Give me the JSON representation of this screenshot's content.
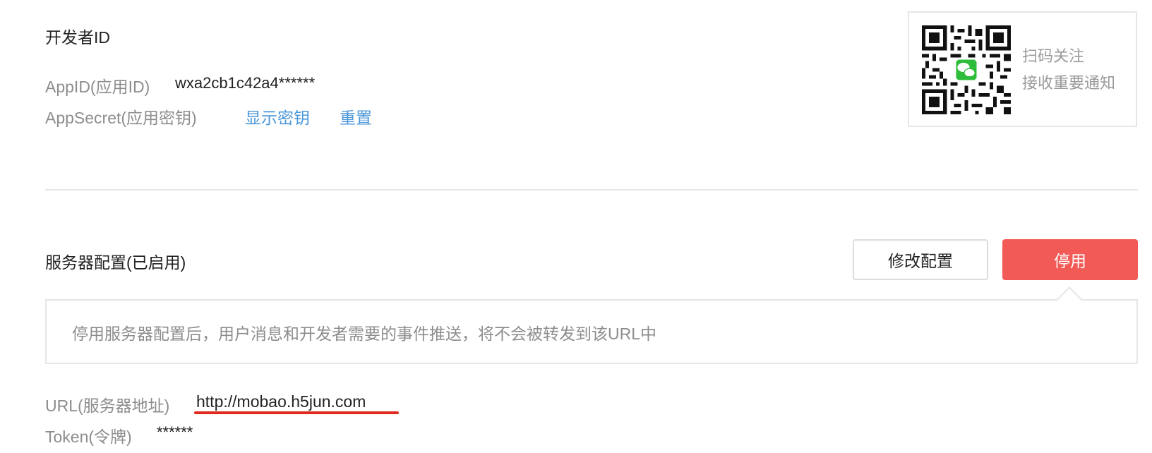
{
  "developer": {
    "title": "开发者ID",
    "appid_label": "AppID(应用ID)",
    "appid_value": "wxa2cb1c42a4******",
    "secret_label": "AppSecret(应用密钥)",
    "show_secret_link": "显示密钥",
    "reset_link": "重置"
  },
  "qr_card": {
    "line1": "扫码关注",
    "line2": "接收重要通知",
    "icon": "wechat-qr-icon"
  },
  "server": {
    "title": "服务器配置(已启用)",
    "edit_button": "修改配置",
    "stop_button": "停用",
    "notice": "停用服务器配置后，用户消息和开发者需要的事件推送，将不会被转发到该URL中",
    "url_label": "URL(服务器地址)",
    "url_value": "http://mobao.h5jun.com",
    "token_label": "Token(令牌)",
    "token_value": "******"
  },
  "colors": {
    "link": "#4b97da",
    "danger": "#f25a55",
    "annotation": "#e0291f"
  }
}
